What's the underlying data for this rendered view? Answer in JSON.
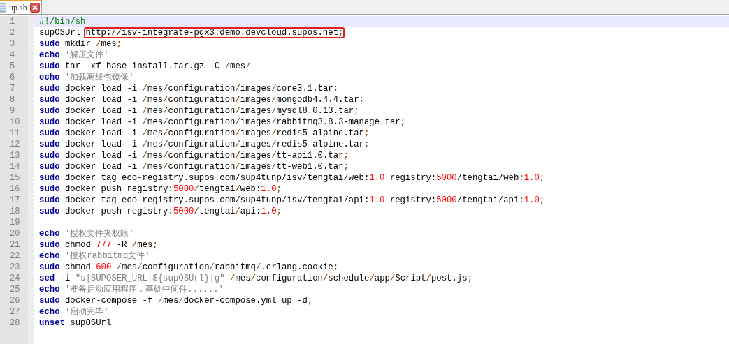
{
  "tabs": [
    {
      "label": "up.sh",
      "selected": true
    }
  ],
  "lines": [
    {
      "number": "1",
      "current": true,
      "tokens": [
        {
          "kind": "comment",
          "text": "#!/bin/sh"
        }
      ]
    },
    {
      "number": "2",
      "current": false,
      "tokens": [
        {
          "kind": "plain",
          "text": "supOSUrl="
        },
        {
          "kind": "url",
          "text": "http://isv-integrate-pgx3.demo.devcloud.supos.net",
          "boxed": true
        },
        {
          "kind": "op",
          "text": ";",
          "boxed": true
        }
      ]
    },
    {
      "number": "3",
      "current": false,
      "tokens": [
        {
          "kind": "keyword",
          "text": "sudo"
        },
        {
          "kind": "plain",
          "text": " mkdir "
        },
        {
          "kind": "path",
          "text": "/mes;"
        }
      ]
    },
    {
      "number": "4",
      "current": false,
      "tokens": [
        {
          "kind": "keyword",
          "text": "echo"
        },
        {
          "kind": "string",
          "text": " '解压文件'"
        }
      ]
    },
    {
      "number": "5",
      "current": false,
      "tokens": [
        {
          "kind": "keyword",
          "text": "sudo"
        },
        {
          "kind": "plain",
          "text": " tar -xf base-install.tar.gz -C "
        },
        {
          "kind": "path",
          "text": "/mes/"
        }
      ]
    },
    {
      "number": "6",
      "current": false,
      "tokens": [
        {
          "kind": "keyword",
          "text": "echo"
        },
        {
          "kind": "string",
          "text": " '加载离线包镜像'"
        }
      ]
    },
    {
      "number": "7",
      "current": false,
      "tokens": [
        {
          "kind": "keyword",
          "text": "sudo"
        },
        {
          "kind": "plain",
          "text": " docker load -i "
        },
        {
          "kind": "path",
          "text": "/mes/configuration/images/core3.1.tar;"
        }
      ]
    },
    {
      "number": "8",
      "current": false,
      "tokens": [
        {
          "kind": "keyword",
          "text": "sudo"
        },
        {
          "kind": "plain",
          "text": " docker load -i "
        },
        {
          "kind": "path",
          "text": "/mes/configuration/images/mongodb4.4.4.tar;"
        }
      ]
    },
    {
      "number": "9",
      "current": false,
      "tokens": [
        {
          "kind": "keyword",
          "text": "sudo"
        },
        {
          "kind": "plain",
          "text": " docker load -i "
        },
        {
          "kind": "path",
          "text": "/mes/configuration/images/mysql8.0.13.tar;"
        }
      ]
    },
    {
      "number": "10",
      "current": false,
      "tokens": [
        {
          "kind": "keyword",
          "text": "sudo"
        },
        {
          "kind": "plain",
          "text": " docker load -i "
        },
        {
          "kind": "path",
          "text": "/mes/configuration/images/rabbitmq3.8.3-manage.tar;"
        }
      ]
    },
    {
      "number": "11",
      "current": false,
      "tokens": [
        {
          "kind": "keyword",
          "text": "sudo"
        },
        {
          "kind": "plain",
          "text": " docker load -i "
        },
        {
          "kind": "path",
          "text": "/mes/configuration/images/redis5-alpine.tar;"
        }
      ]
    },
    {
      "number": "12",
      "current": false,
      "tokens": [
        {
          "kind": "keyword",
          "text": "sudo"
        },
        {
          "kind": "plain",
          "text": " docker load -i "
        },
        {
          "kind": "path",
          "text": "/mes/configuration/images/redis5-alpine.tar;"
        }
      ]
    },
    {
      "number": "13",
      "current": false,
      "tokens": [
        {
          "kind": "keyword",
          "text": "sudo"
        },
        {
          "kind": "plain",
          "text": " docker load -i "
        },
        {
          "kind": "path",
          "text": "/mes/configuration/images/tt-api1.0.tar;"
        }
      ]
    },
    {
      "number": "14",
      "current": false,
      "tokens": [
        {
          "kind": "keyword",
          "text": "sudo"
        },
        {
          "kind": "plain",
          "text": " docker load -i "
        },
        {
          "kind": "path",
          "text": "/mes/configuration/images/tt-web1.0.tar;"
        }
      ]
    },
    {
      "number": "15",
      "current": false,
      "tokens": [
        {
          "kind": "keyword",
          "text": "sudo"
        },
        {
          "kind": "plain",
          "text": " docker tag eco-registry.supos.com/sup4tunp/isv/tengtai/web:"
        },
        {
          "kind": "number",
          "text": "1.0"
        },
        {
          "kind": "plain",
          "text": " registry:"
        },
        {
          "kind": "number",
          "text": "5000"
        },
        {
          "kind": "plain",
          "text": "/tengtai/web:"
        },
        {
          "kind": "number",
          "text": "1.0"
        },
        {
          "kind": "op",
          "text": ";"
        }
      ]
    },
    {
      "number": "16",
      "current": false,
      "tokens": [
        {
          "kind": "keyword",
          "text": "sudo"
        },
        {
          "kind": "plain",
          "text": " docker push registry:"
        },
        {
          "kind": "number",
          "text": "5000"
        },
        {
          "kind": "path",
          "text": "/tengtai/web:"
        },
        {
          "kind": "number",
          "text": "1.0"
        },
        {
          "kind": "op",
          "text": ";"
        }
      ]
    },
    {
      "number": "17",
      "current": false,
      "tokens": [
        {
          "kind": "keyword",
          "text": "sudo"
        },
        {
          "kind": "plain",
          "text": " docker tag eco-registry.supos.com/sup4tunp/isv/tengtai/api:"
        },
        {
          "kind": "number",
          "text": "1.0"
        },
        {
          "kind": "plain",
          "text": " registry:"
        },
        {
          "kind": "number",
          "text": "5000"
        },
        {
          "kind": "plain",
          "text": "/tengtai/api:"
        },
        {
          "kind": "number",
          "text": "1.0"
        },
        {
          "kind": "op",
          "text": ";"
        }
      ]
    },
    {
      "number": "18",
      "current": false,
      "tokens": [
        {
          "kind": "keyword",
          "text": "sudo"
        },
        {
          "kind": "plain",
          "text": " docker push registry:"
        },
        {
          "kind": "number",
          "text": "5000"
        },
        {
          "kind": "path",
          "text": "/tengtai/api:"
        },
        {
          "kind": "number",
          "text": "1.0"
        },
        {
          "kind": "op",
          "text": ";"
        }
      ]
    },
    {
      "number": "19",
      "current": false
    },
    {
      "number": "20",
      "current": false,
      "tokens": [
        {
          "kind": "keyword",
          "text": "echo"
        },
        {
          "kind": "string",
          "text": " '授权文件夹权限'"
        }
      ]
    },
    {
      "number": "21",
      "current": false,
      "tokens": [
        {
          "kind": "keyword",
          "text": "sudo"
        },
        {
          "kind": "plain",
          "text": " chmod "
        },
        {
          "kind": "number",
          "text": "777"
        },
        {
          "kind": "plain",
          "text": " -R "
        },
        {
          "kind": "path",
          "text": "/mes;"
        }
      ]
    },
    {
      "number": "22",
      "current": false,
      "tokens": [
        {
          "kind": "keyword",
          "text": "echo"
        },
        {
          "kind": "string",
          "text": " '授权rabbitmq文件'"
        }
      ]
    },
    {
      "number": "23",
      "current": false,
      "tokens": [
        {
          "kind": "keyword",
          "text": "sudo"
        },
        {
          "kind": "plain",
          "text": " chmod "
        },
        {
          "kind": "number",
          "text": "600"
        },
        {
          "kind": "path",
          "text": " /mes/configuration/rabbitmq/.erlang.cookie;"
        }
      ]
    },
    {
      "number": "24",
      "current": false,
      "tokens": [
        {
          "kind": "keyword",
          "text": "sed"
        },
        {
          "kind": "plain",
          "text": " -i "
        },
        {
          "kind": "string",
          "text": "\"s|SUPOSER_URL|${supOSUrl}|g\""
        },
        {
          "kind": "path",
          "text": " /mes/configuration/schedule/app/Script/post.js;"
        }
      ]
    },
    {
      "number": "25",
      "current": false,
      "tokens": [
        {
          "kind": "keyword",
          "text": "echo"
        },
        {
          "kind": "string",
          "text": " '准备启动应用程序，基础中间件......'"
        }
      ]
    },
    {
      "number": "26",
      "current": false,
      "tokens": [
        {
          "kind": "keyword",
          "text": "sudo"
        },
        {
          "kind": "plain",
          "text": " docker-compose -f "
        },
        {
          "kind": "path",
          "text": "/mes/docker-compose.yml"
        },
        {
          "kind": "plain",
          "text": " up -d"
        },
        {
          "kind": "op",
          "text": ";"
        }
      ]
    },
    {
      "number": "27",
      "current": false,
      "tokens": [
        {
          "kind": "keyword",
          "text": "echo"
        },
        {
          "kind": "string",
          "text": " '启动完毕'"
        }
      ]
    },
    {
      "number": "28",
      "current": false,
      "tokens": [
        {
          "kind": "keyword",
          "text": "unset"
        },
        {
          "kind": "plain",
          "text": " supOSUrl"
        }
      ]
    }
  ]
}
